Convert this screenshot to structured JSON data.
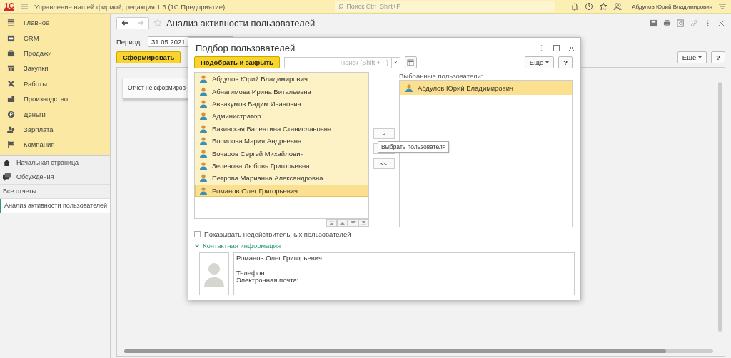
{
  "top_bar": {
    "logo": "1С",
    "title": "Управление нашей фирмой, редакция 1.6  (1С:Предприятие)",
    "search_placeholder": "Поиск Ctrl+Shift+F",
    "user": "Абдулов Юрий Владимирович"
  },
  "sidebar": {
    "sections": [
      {
        "label": "Главное",
        "kind": "menu"
      },
      {
        "label": "CRM",
        "kind": "crm"
      },
      {
        "label": "Продажи",
        "kind": "sales"
      },
      {
        "label": "Закупки",
        "kind": "purchases"
      },
      {
        "label": "Работы",
        "kind": "works"
      },
      {
        "label": "Производство",
        "kind": "production"
      },
      {
        "label": "Деньги",
        "kind": "money"
      },
      {
        "label": "Зарплата",
        "kind": "salary"
      },
      {
        "label": "Компания",
        "kind": "company"
      }
    ],
    "nav": [
      {
        "label": "Начальная страница",
        "kind": "home",
        "selected": false
      },
      {
        "label": "Обсуждения",
        "kind": "chat",
        "selected": false
      },
      {
        "label": "Все отчеты",
        "kind": "plain",
        "selected": false
      },
      {
        "label": "Анализ активности пользователей",
        "kind": "plain",
        "selected": true
      }
    ]
  },
  "form": {
    "title": "Анализ активности пользователей",
    "period_label": "Период:",
    "period_value": "31.05.2021",
    "generate_button": "Сформировать",
    "more_button": "Еще",
    "help_button": "?",
    "notice": "Отчет не сформиров"
  },
  "dialog": {
    "title": "Подбор пользователей",
    "pick_button": "Подобрать и закрыть",
    "search_placeholder": "Поиск (Shift + F)",
    "clear_button": "×",
    "more_button": "Еще",
    "help_button": "?",
    "users": [
      {
        "name": "Абдулов Юрий Владимирович",
        "selected": false
      },
      {
        "name": "Абнагимова Ирина Витальевна",
        "selected": false
      },
      {
        "name": "Аввакумов Вадим Иванович",
        "selected": false
      },
      {
        "name": "Администратор",
        "selected": false
      },
      {
        "name": "Бакинская Валентина Станиславовна",
        "selected": false
      },
      {
        "name": "Борисова Мария Андреевна",
        "selected": false
      },
      {
        "name": "Бочаров Сергей Михайлович",
        "selected": false
      },
      {
        "name": "Зеленова Любовь Григорьевна",
        "selected": false
      },
      {
        "name": "Петрова Марианна Александровна",
        "selected": false
      },
      {
        "name": "Романов Олег Григорьевич",
        "selected": true
      }
    ],
    "selected_label": "Выбранные пользователи:",
    "selected_users": [
      {
        "name": "Абдулов Юрий Владимирович",
        "selected": true
      }
    ],
    "add_button": ">",
    "remove_all_button": "<<",
    "tooltip": "Выбрать пользователя",
    "show_invalid": {
      "label": "Показывать недействительных пользователей",
      "checked": false
    },
    "contact": {
      "label": "Контактная информация",
      "expanded": true,
      "name": "Романов Олег Григорьевич",
      "phone_label": "Телефон:",
      "email_label": "Электронная почта:"
    }
  }
}
